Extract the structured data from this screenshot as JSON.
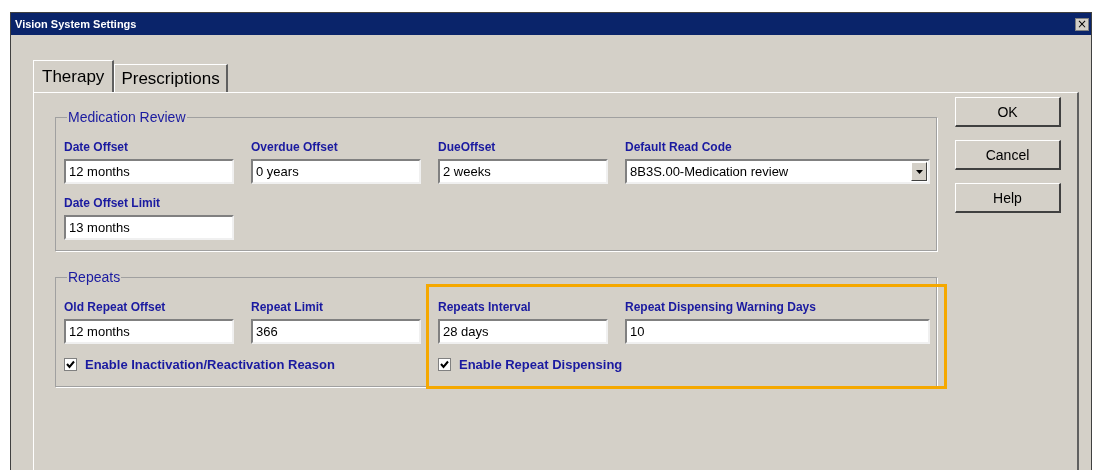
{
  "window": {
    "title": "Vision System Settings",
    "close": "×"
  },
  "tabs": [
    {
      "label": "Therapy",
      "selected": true
    },
    {
      "label": "Prescriptions",
      "selected": false
    }
  ],
  "medication_review": {
    "title": "Medication Review",
    "fields": [
      {
        "kind": "text",
        "label": "Date Offset",
        "value": "12 months"
      },
      {
        "kind": "text",
        "label": "Overdue Offset",
        "value": "0 years"
      },
      {
        "kind": "text",
        "label": "DueOffset",
        "value": "2 weeks"
      },
      {
        "kind": "dropdown",
        "label": "Default Read Code",
        "value": "8B3S.00-Medication review"
      },
      {
        "kind": "text",
        "label": "Date Offset Limit",
        "value": "13 months"
      }
    ]
  },
  "repeats": {
    "title": "Repeats",
    "sections": [
      {
        "highlighted": false,
        "fields": [
          {
            "kind": "text",
            "label": "Old Repeat Offset",
            "value": "12 months"
          },
          {
            "kind": "text",
            "label": "Repeat Limit",
            "value": "366"
          }
        ],
        "checkbox": {
          "label": "Enable Inactivation/Reactivation Reason",
          "checked": true
        }
      },
      {
        "highlighted": true,
        "fields": [
          {
            "kind": "text",
            "label": "Repeats Interval",
            "value": "28 days"
          },
          {
            "kind": "wide",
            "label": "Repeat Dispensing Warning Days",
            "value": "10"
          }
        ],
        "checkbox": {
          "label": "Enable Repeat Dispensing",
          "checked": true
        }
      }
    ]
  },
  "buttons": [
    "OK",
    "Cancel",
    "Help"
  ]
}
